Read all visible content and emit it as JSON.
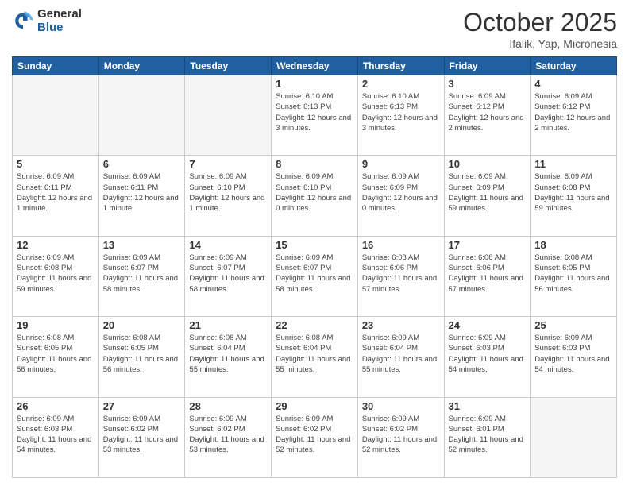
{
  "header": {
    "logo_general": "General",
    "logo_blue": "Blue",
    "title": "October 2025",
    "location": "Ifalik, Yap, Micronesia"
  },
  "weekdays": [
    "Sunday",
    "Monday",
    "Tuesday",
    "Wednesday",
    "Thursday",
    "Friday",
    "Saturday"
  ],
  "weeks": [
    [
      {
        "day": "",
        "text": ""
      },
      {
        "day": "",
        "text": ""
      },
      {
        "day": "",
        "text": ""
      },
      {
        "day": "1",
        "text": "Sunrise: 6:10 AM\nSunset: 6:13 PM\nDaylight: 12 hours and 3 minutes."
      },
      {
        "day": "2",
        "text": "Sunrise: 6:10 AM\nSunset: 6:13 PM\nDaylight: 12 hours and 3 minutes."
      },
      {
        "day": "3",
        "text": "Sunrise: 6:09 AM\nSunset: 6:12 PM\nDaylight: 12 hours and 2 minutes."
      },
      {
        "day": "4",
        "text": "Sunrise: 6:09 AM\nSunset: 6:12 PM\nDaylight: 12 hours and 2 minutes."
      }
    ],
    [
      {
        "day": "5",
        "text": "Sunrise: 6:09 AM\nSunset: 6:11 PM\nDaylight: 12 hours and 1 minute."
      },
      {
        "day": "6",
        "text": "Sunrise: 6:09 AM\nSunset: 6:11 PM\nDaylight: 12 hours and 1 minute."
      },
      {
        "day": "7",
        "text": "Sunrise: 6:09 AM\nSunset: 6:10 PM\nDaylight: 12 hours and 1 minute."
      },
      {
        "day": "8",
        "text": "Sunrise: 6:09 AM\nSunset: 6:10 PM\nDaylight: 12 hours and 0 minutes."
      },
      {
        "day": "9",
        "text": "Sunrise: 6:09 AM\nSunset: 6:09 PM\nDaylight: 12 hours and 0 minutes."
      },
      {
        "day": "10",
        "text": "Sunrise: 6:09 AM\nSunset: 6:09 PM\nDaylight: 11 hours and 59 minutes."
      },
      {
        "day": "11",
        "text": "Sunrise: 6:09 AM\nSunset: 6:08 PM\nDaylight: 11 hours and 59 minutes."
      }
    ],
    [
      {
        "day": "12",
        "text": "Sunrise: 6:09 AM\nSunset: 6:08 PM\nDaylight: 11 hours and 59 minutes."
      },
      {
        "day": "13",
        "text": "Sunrise: 6:09 AM\nSunset: 6:07 PM\nDaylight: 11 hours and 58 minutes."
      },
      {
        "day": "14",
        "text": "Sunrise: 6:09 AM\nSunset: 6:07 PM\nDaylight: 11 hours and 58 minutes."
      },
      {
        "day": "15",
        "text": "Sunrise: 6:09 AM\nSunset: 6:07 PM\nDaylight: 11 hours and 58 minutes."
      },
      {
        "day": "16",
        "text": "Sunrise: 6:08 AM\nSunset: 6:06 PM\nDaylight: 11 hours and 57 minutes."
      },
      {
        "day": "17",
        "text": "Sunrise: 6:08 AM\nSunset: 6:06 PM\nDaylight: 11 hours and 57 minutes."
      },
      {
        "day": "18",
        "text": "Sunrise: 6:08 AM\nSunset: 6:05 PM\nDaylight: 11 hours and 56 minutes."
      }
    ],
    [
      {
        "day": "19",
        "text": "Sunrise: 6:08 AM\nSunset: 6:05 PM\nDaylight: 11 hours and 56 minutes."
      },
      {
        "day": "20",
        "text": "Sunrise: 6:08 AM\nSunset: 6:05 PM\nDaylight: 11 hours and 56 minutes."
      },
      {
        "day": "21",
        "text": "Sunrise: 6:08 AM\nSunset: 6:04 PM\nDaylight: 11 hours and 55 minutes."
      },
      {
        "day": "22",
        "text": "Sunrise: 6:08 AM\nSunset: 6:04 PM\nDaylight: 11 hours and 55 minutes."
      },
      {
        "day": "23",
        "text": "Sunrise: 6:09 AM\nSunset: 6:04 PM\nDaylight: 11 hours and 55 minutes."
      },
      {
        "day": "24",
        "text": "Sunrise: 6:09 AM\nSunset: 6:03 PM\nDaylight: 11 hours and 54 minutes."
      },
      {
        "day": "25",
        "text": "Sunrise: 6:09 AM\nSunset: 6:03 PM\nDaylight: 11 hours and 54 minutes."
      }
    ],
    [
      {
        "day": "26",
        "text": "Sunrise: 6:09 AM\nSunset: 6:03 PM\nDaylight: 11 hours and 54 minutes."
      },
      {
        "day": "27",
        "text": "Sunrise: 6:09 AM\nSunset: 6:02 PM\nDaylight: 11 hours and 53 minutes."
      },
      {
        "day": "28",
        "text": "Sunrise: 6:09 AM\nSunset: 6:02 PM\nDaylight: 11 hours and 53 minutes."
      },
      {
        "day": "29",
        "text": "Sunrise: 6:09 AM\nSunset: 6:02 PM\nDaylight: 11 hours and 52 minutes."
      },
      {
        "day": "30",
        "text": "Sunrise: 6:09 AM\nSunset: 6:02 PM\nDaylight: 11 hours and 52 minutes."
      },
      {
        "day": "31",
        "text": "Sunrise: 6:09 AM\nSunset: 6:01 PM\nDaylight: 11 hours and 52 minutes."
      },
      {
        "day": "",
        "text": ""
      }
    ]
  ]
}
